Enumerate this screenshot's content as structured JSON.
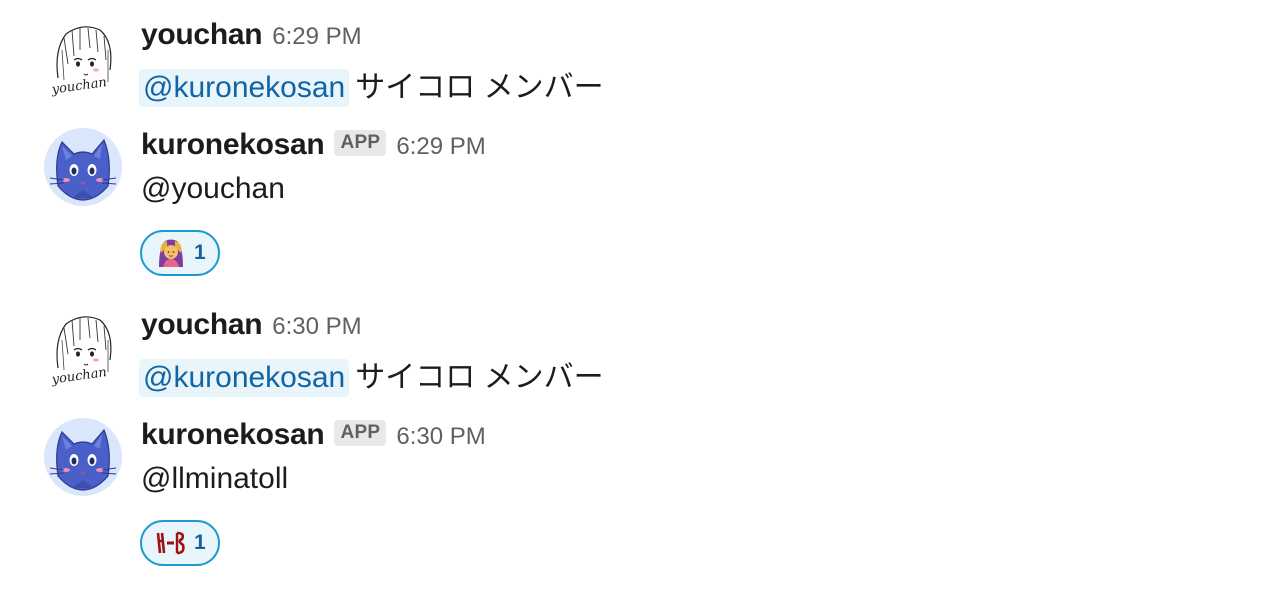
{
  "messages": [
    {
      "user": "youchan",
      "avatar": "youchan-sketch-avatar",
      "is_app": false,
      "time": "6:29 PM",
      "mention": "@kuronekosan",
      "text": "サイコロ メンバー"
    },
    {
      "user": "kuronekosan",
      "avatar": "blue-cat-avatar",
      "is_app": true,
      "badge": "APP",
      "time": "6:29 PM",
      "text": "@youchan",
      "reaction": {
        "emoji": "person-gesturing-ok-emoji",
        "count": "1"
      }
    },
    {
      "user": "youchan",
      "avatar": "youchan-sketch-avatar",
      "is_app": false,
      "time": "6:30 PM",
      "mention": "@kuronekosan",
      "text": "サイコロ メンバー"
    },
    {
      "user": "kuronekosan",
      "avatar": "blue-cat-avatar",
      "is_app": true,
      "badge": "APP",
      "time": "6:30 PM",
      "text": "@llminatoll",
      "reaction": {
        "emoji": "custom-red-text-emoji",
        "count": "1"
      }
    }
  ],
  "colors": {
    "mention_text": "#1264a3",
    "mention_bg": "#e8f5fa",
    "reaction_border": "#1d9bd1",
    "badge_bg": "#e8e8e8",
    "timestamp": "#616061"
  }
}
